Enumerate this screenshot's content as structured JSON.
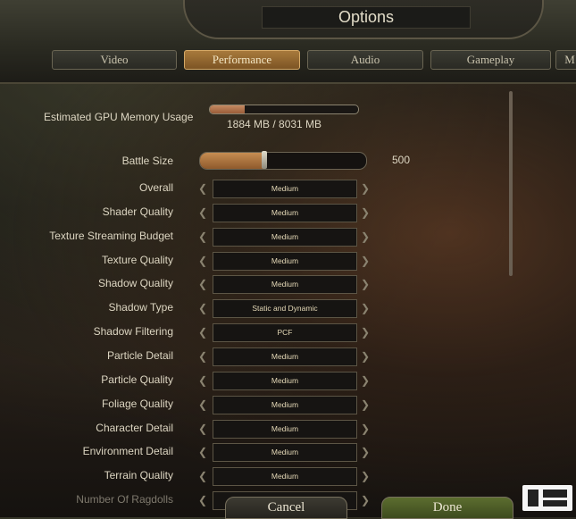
{
  "window": {
    "title": "Options"
  },
  "tabs": [
    {
      "label": "Video"
    },
    {
      "label": "Performance",
      "active": true
    },
    {
      "label": "Audio"
    },
    {
      "label": "Gameplay"
    },
    {
      "label": "M"
    }
  ],
  "gpu_memory": {
    "label": "Estimated GPU Memory Usage",
    "used_mb": 1884,
    "total_mb": 8031,
    "text": "1884 MB / 8031 MB"
  },
  "battle_size": {
    "label": "Battle Size",
    "value": "500",
    "fraction": 0.39
  },
  "settings": [
    {
      "label": "Overall",
      "value": "Medium"
    },
    {
      "label": "Shader Quality",
      "value": "Medium"
    },
    {
      "label": "Texture Streaming Budget",
      "value": "Medium"
    },
    {
      "label": "Texture Quality",
      "value": "Medium"
    },
    {
      "label": "Shadow Quality",
      "value": "Medium"
    },
    {
      "label": "Shadow Type",
      "value": "Static and Dynamic"
    },
    {
      "label": "Shadow Filtering",
      "value": "PCF"
    },
    {
      "label": "Particle Detail",
      "value": "Medium"
    },
    {
      "label": "Particle Quality",
      "value": "Medium"
    },
    {
      "label": "Foliage Quality",
      "value": "Medium"
    },
    {
      "label": "Character Detail",
      "value": "Medium"
    },
    {
      "label": "Environment Detail",
      "value": "Medium"
    },
    {
      "label": "Terrain Quality",
      "value": "Medium"
    },
    {
      "label": "Number Of Ragdolls",
      "value": ""
    }
  ],
  "buttons": {
    "cancel": "Cancel",
    "done": "Done"
  },
  "colors": {
    "accent": "#a87a3c",
    "done_button": "#4c5c28",
    "text": "#ddd6c2"
  },
  "icons": {
    "left_arrow": "chevron-left-icon",
    "right_arrow": "chevron-right-icon"
  }
}
